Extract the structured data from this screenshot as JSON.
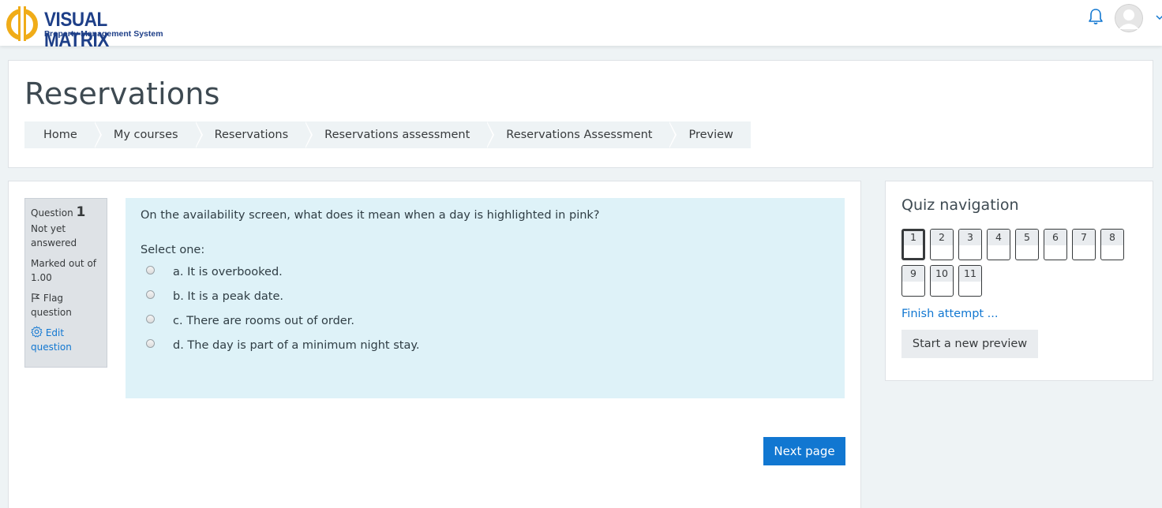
{
  "brand": {
    "title": "VISUAL MATRIX",
    "subtitle": "Property Management System",
    "colors": {
      "navy": "#1e3f88",
      "gold": "#f0ac18"
    }
  },
  "header": {
    "page_title": "Reservations",
    "breadcrumb": [
      "Home",
      "My courses",
      "Reservations",
      "Reservations assessment",
      "Reservations Assessment",
      "Preview"
    ]
  },
  "question_info": {
    "label": "Question",
    "number": "1",
    "status": "Not yet answered",
    "marked": "Marked out of 1.00",
    "flag": "Flag question",
    "edit": "Edit question"
  },
  "question": {
    "text": "On the availability screen, what does it mean when a day is highlighted in pink?",
    "prompt": "Select one:",
    "answers": [
      "a. It is overbooked.",
      "b. It is a peak date.",
      "c. There are rooms out of order.",
      "d. The day is part of a minimum night stay."
    ]
  },
  "actions": {
    "next": "Next page"
  },
  "quiz_nav": {
    "title": "Quiz navigation",
    "questions": [
      "1",
      "2",
      "3",
      "4",
      "5",
      "6",
      "7",
      "8",
      "9",
      "10",
      "11"
    ],
    "current": "1",
    "finish": "Finish attempt ...",
    "new_preview": "Start a new preview"
  },
  "colors": {
    "primary": "#1177d1",
    "question_bg": "#def2f8",
    "page_bg": "#eef3f5"
  },
  "icons": [
    "bell-icon",
    "avatar",
    "caret-down-icon",
    "flag-icon",
    "gear-icon"
  ]
}
